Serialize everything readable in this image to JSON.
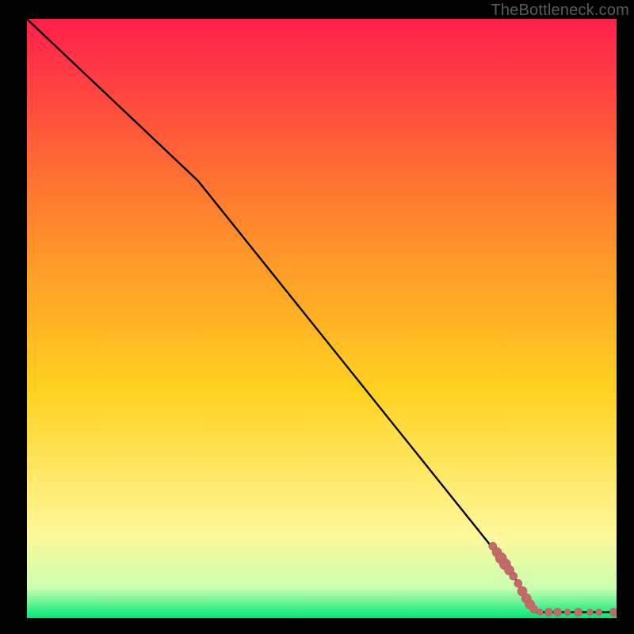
{
  "watermark": "TheBottleneck.com",
  "colors": {
    "gradient_top": "#ff1f4b",
    "gradient_upper_mid": "#ff8a2b",
    "gradient_mid": "#ffd21f",
    "gradient_lower_mid": "#fff79a",
    "gradient_near_bottom": "#c9ffb0",
    "gradient_bottom": "#00e878",
    "line": "#000000",
    "marker_fill": "#c56a6a",
    "marker_stroke": "#b35a5a",
    "frame": "#000000"
  },
  "chart_data": {
    "type": "line",
    "title": "",
    "xlabel": "",
    "ylabel": "",
    "xlim": [
      0,
      100
    ],
    "ylim": [
      0,
      100
    ],
    "grid": false,
    "legend": false,
    "series": [
      {
        "name": "curve",
        "style": "line",
        "color": "#000000",
        "x": [
          0,
          29,
          82,
          86,
          100
        ],
        "y": [
          100,
          73,
          8,
          1,
          1
        ]
      },
      {
        "name": "data-points",
        "style": "marker",
        "color": "#c56a6a",
        "points": [
          {
            "x": 79.0,
            "y": 12.0,
            "r": 5
          },
          {
            "x": 79.7,
            "y": 11.0,
            "r": 6
          },
          {
            "x": 80.4,
            "y": 10.0,
            "r": 7
          },
          {
            "x": 81.1,
            "y": 9.0,
            "r": 7
          },
          {
            "x": 81.8,
            "y": 8.0,
            "r": 6
          },
          {
            "x": 82.5,
            "y": 7.0,
            "r": 5
          },
          {
            "x": 83.3,
            "y": 5.8,
            "r": 5
          },
          {
            "x": 84.0,
            "y": 4.5,
            "r": 6
          },
          {
            "x": 84.7,
            "y": 3.3,
            "r": 6
          },
          {
            "x": 85.3,
            "y": 2.3,
            "r": 6
          },
          {
            "x": 86.0,
            "y": 1.5,
            "r": 5
          },
          {
            "x": 87.0,
            "y": 1.0,
            "r": 4
          },
          {
            "x": 88.5,
            "y": 1.0,
            "r": 5
          },
          {
            "x": 90.0,
            "y": 1.0,
            "r": 5
          },
          {
            "x": 91.7,
            "y": 1.0,
            "r": 4
          },
          {
            "x": 93.5,
            "y": 1.0,
            "r": 5
          },
          {
            "x": 95.5,
            "y": 1.0,
            "r": 4
          },
          {
            "x": 97.0,
            "y": 1.0,
            "r": 4
          },
          {
            "x": 99.5,
            "y": 1.0,
            "r": 5
          }
        ]
      }
    ]
  }
}
